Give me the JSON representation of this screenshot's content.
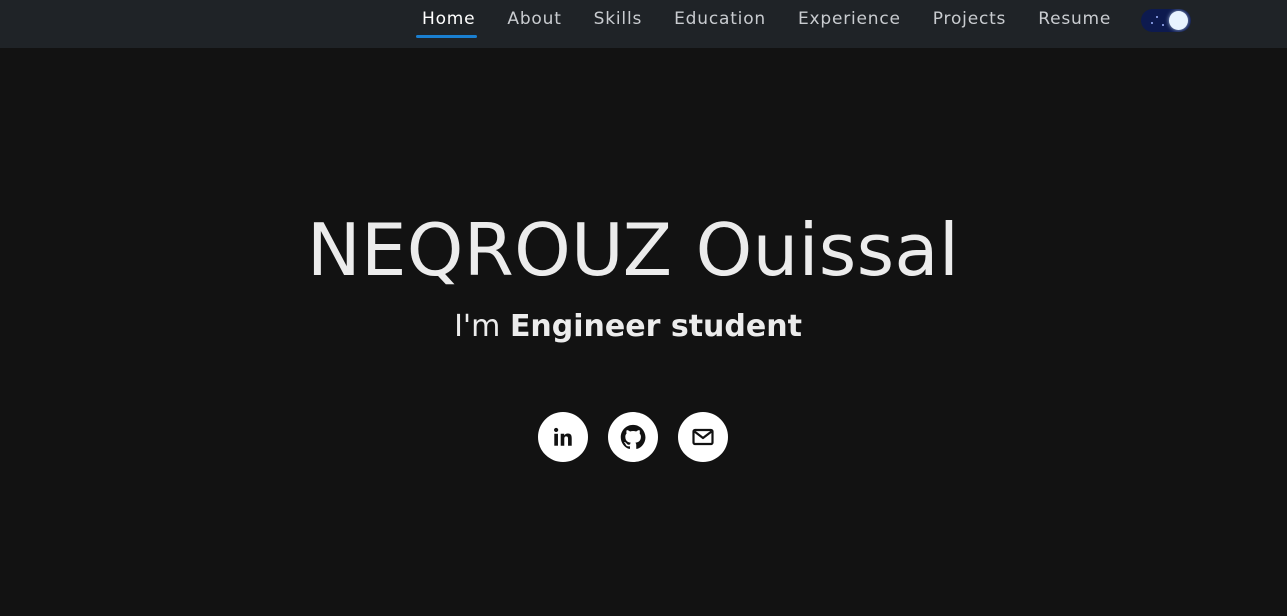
{
  "nav": {
    "items": [
      {
        "label": "Home",
        "active": true
      },
      {
        "label": "About"
      },
      {
        "label": "Skills"
      },
      {
        "label": "Education"
      },
      {
        "label": "Experience"
      },
      {
        "label": "Projects"
      },
      {
        "label": "Resume"
      }
    ],
    "theme_toggle": {
      "icon": "moon-stars-toggle",
      "state": "dark"
    }
  },
  "hero": {
    "name": "NEQROUZ Ouissal",
    "tagline_prefix": "I'm ",
    "tagline_role": "Engineer student"
  },
  "socials": [
    {
      "icon": "linkedin-icon"
    },
    {
      "icon": "github-icon"
    },
    {
      "icon": "mail-icon"
    }
  ],
  "colors": {
    "background": "#121212",
    "navbar": "#1f2327",
    "accent": "#1a7fd0",
    "toggle_bg": "#0d1a4f"
  }
}
